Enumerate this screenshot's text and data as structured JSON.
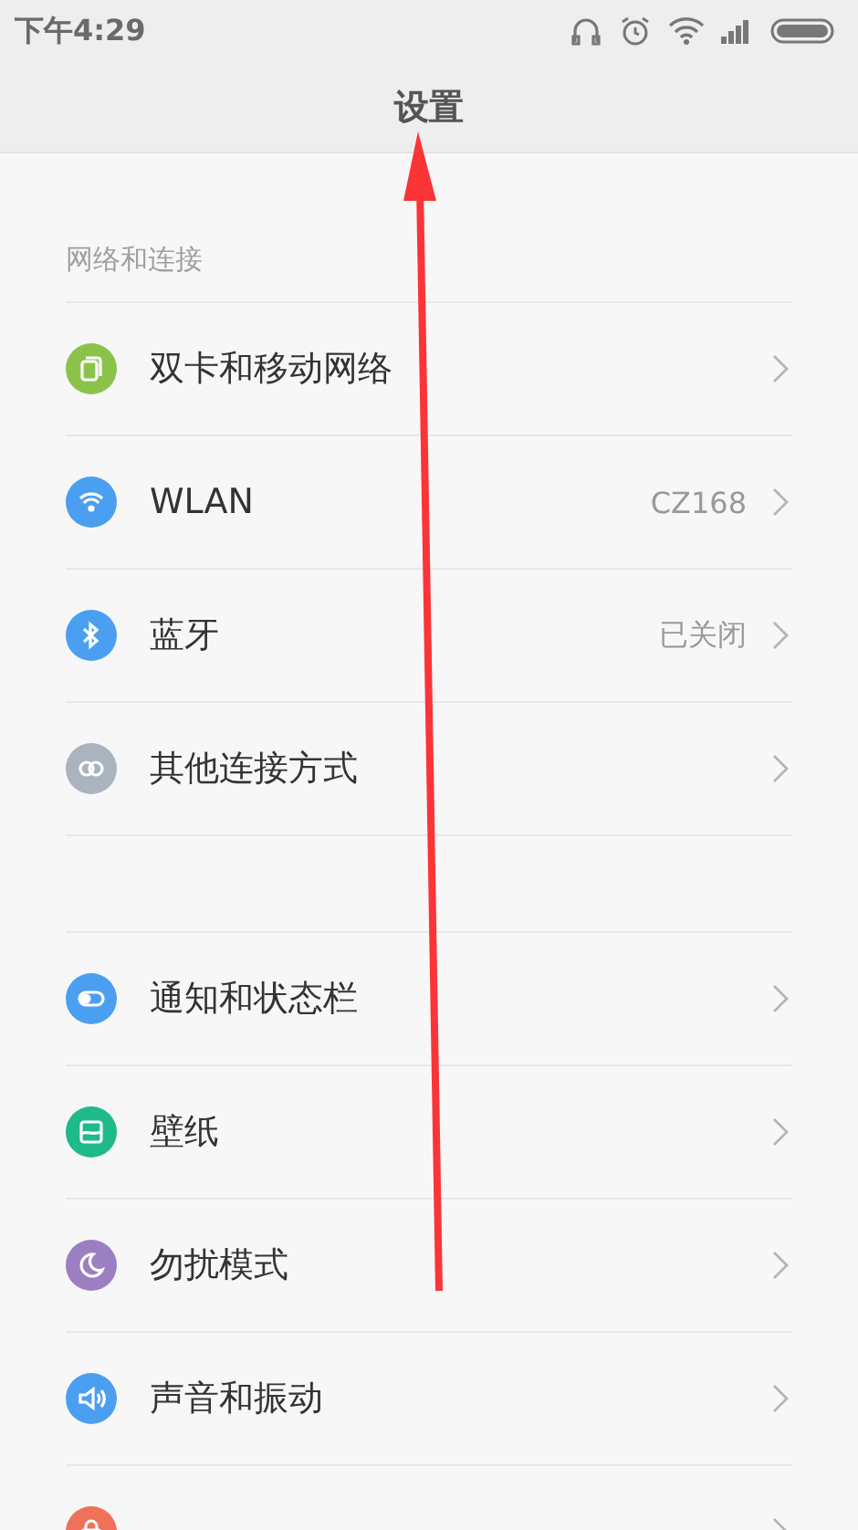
{
  "status_bar": {
    "time": "下午4:29"
  },
  "title": "设置",
  "sections": [
    {
      "header": "网络和连接",
      "items": [
        {
          "label": "双卡和移动网络",
          "kind": "sim",
          "color": "#8bc34a"
        },
        {
          "label": "WLAN",
          "value": "CZ168",
          "kind": "wifi",
          "color": "#4a9ff0"
        },
        {
          "label": "蓝牙",
          "value": "已关闭",
          "kind": "bluetooth",
          "color": "#4a9ff0"
        },
        {
          "label": "其他连接方式",
          "kind": "link",
          "color": "#a9b4bf"
        }
      ]
    },
    {
      "items": [
        {
          "label": "通知和状态栏",
          "kind": "toggle",
          "color": "#4a9ff0"
        },
        {
          "label": "壁纸",
          "kind": "image",
          "color": "#1fba8a"
        },
        {
          "label": "勿扰模式",
          "kind": "moon",
          "color": "#9b7fc2"
        },
        {
          "label": "声音和振动",
          "kind": "speaker",
          "color": "#4a9ff0"
        },
        {
          "kind": "lock",
          "color": "#f0715a"
        }
      ]
    }
  ]
}
